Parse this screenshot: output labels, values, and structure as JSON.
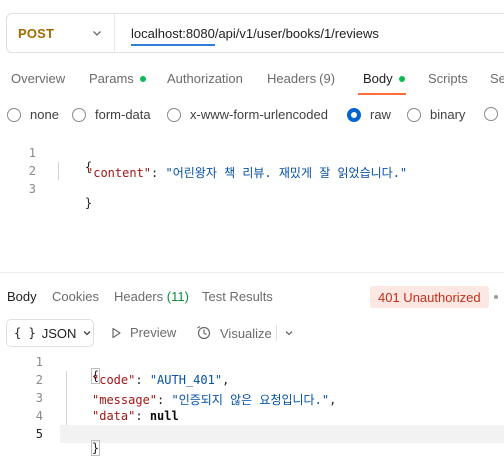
{
  "request": {
    "method": "POST",
    "url": "localhost:8080/api/v1/user/books/1/reviews"
  },
  "request_tabs": [
    {
      "label": "Overview"
    },
    {
      "label": "Params",
      "dot": true
    },
    {
      "label": "Authorization"
    },
    {
      "label": "Headers",
      "count": "(9)"
    },
    {
      "label": "Body",
      "dot": true,
      "active": true
    },
    {
      "label": "Scripts"
    },
    {
      "label": "Se"
    }
  ],
  "body_types": [
    {
      "label": "none",
      "selected": false
    },
    {
      "label": "form-data",
      "selected": false
    },
    {
      "label": "x-www-form-urlencoded",
      "selected": false
    },
    {
      "label": "raw",
      "selected": true
    },
    {
      "label": "binary",
      "selected": false
    },
    {
      "label": "",
      "selected": false
    }
  ],
  "request_body": {
    "line_numbers": [
      "1",
      "2",
      "3"
    ],
    "open_brace": "{",
    "close_brace": "}",
    "content_key": "\"content\"",
    "content_value": "\"어린왕자 책 리뷰. 재밌게 잘 읽었습니다.\""
  },
  "response_tabs": {
    "body": "Body",
    "cookies": "Cookies",
    "headers": "Headers",
    "headers_count": "(11)",
    "test_results": "Test Results"
  },
  "status": "401 Unauthorized",
  "response_tools": {
    "format_braces": "{ }",
    "format": "JSON",
    "preview": "Preview",
    "visualize": "Visualize"
  },
  "response_body": {
    "line_numbers": [
      "1",
      "2",
      "3",
      "4",
      "5"
    ],
    "open_brace": "{",
    "close_brace": "}",
    "code_key": "\"code\"",
    "code_value": "\"AUTH_401\"",
    "message_key": "\"message\"",
    "message_value": "\"인증되지 않은 요청입니다.\"",
    "data_key": "\"data\"",
    "data_value": "null"
  },
  "colors": {
    "accent": "#ff6c37",
    "method_post": "#a36b00",
    "status_error_bg": "#fde7e2",
    "status_error_text": "#c2311c",
    "radio_selected": "#0265d2",
    "dot_green": "#0cbb52"
  }
}
